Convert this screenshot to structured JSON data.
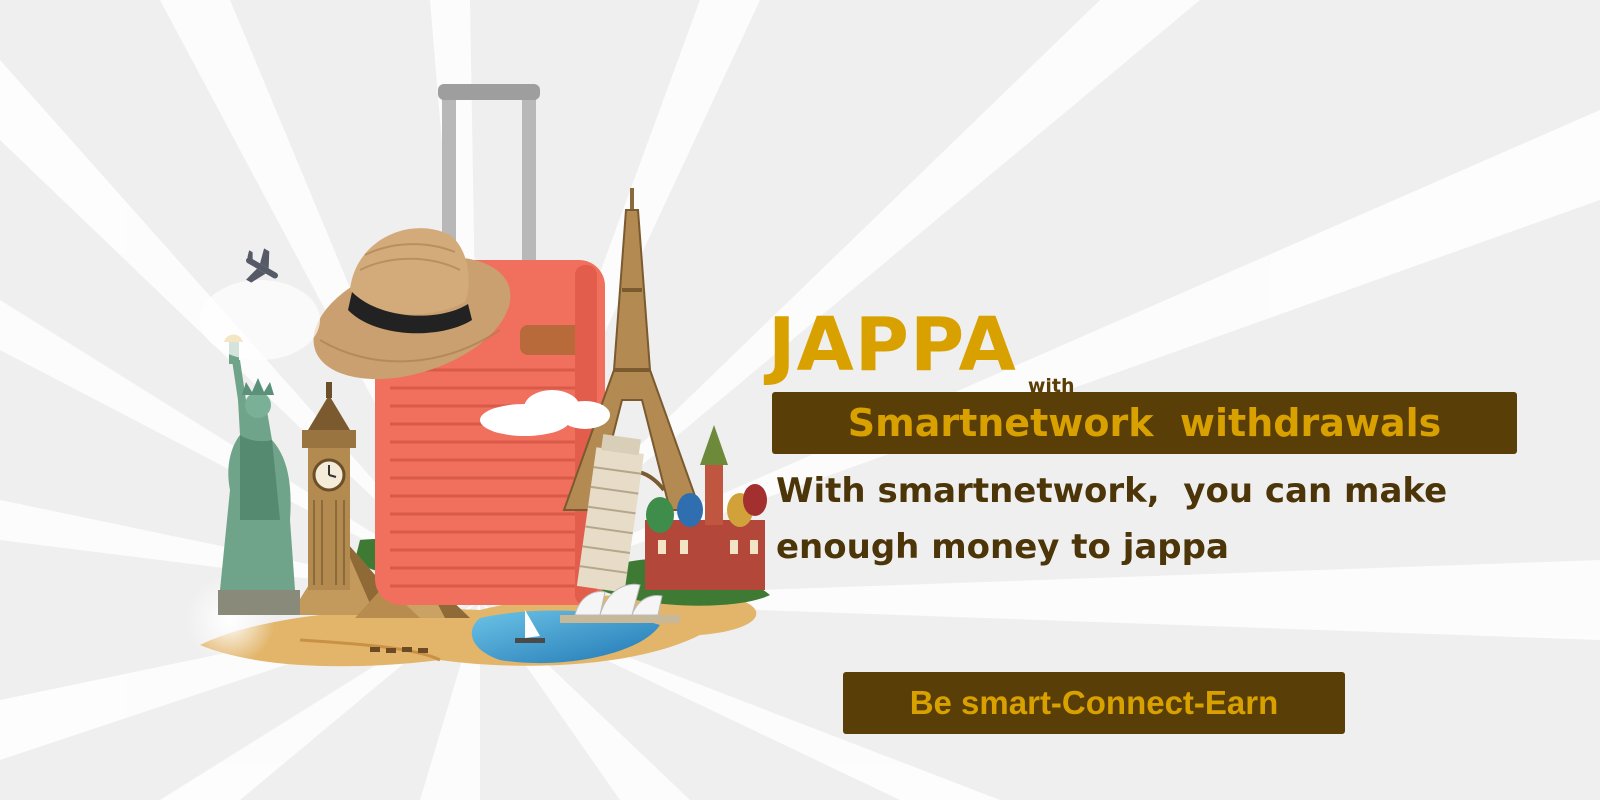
{
  "headline": {
    "main": "JAPPA",
    "small": "with",
    "banner": "Smartnetwork  withdrawals"
  },
  "description": {
    "line1": "With smartnetwork,  you can make",
    "line2": "enough money to jappa"
  },
  "cta": {
    "label": "Be smart-Connect-Earn"
  },
  "colors": {
    "gold": "#d9a100",
    "brown": "#5a3e08",
    "background": "#efefef",
    "suitcase": "#f0705d"
  },
  "illustration": {
    "items": [
      "airplane-icon",
      "statue-of-liberty",
      "big-ben",
      "pyramids",
      "suitcase",
      "straw-hat",
      "eiffel-tower",
      "leaning-tower",
      "st-basils-cathedral",
      "sydney-opera-house",
      "sailboat",
      "cloud"
    ]
  }
}
